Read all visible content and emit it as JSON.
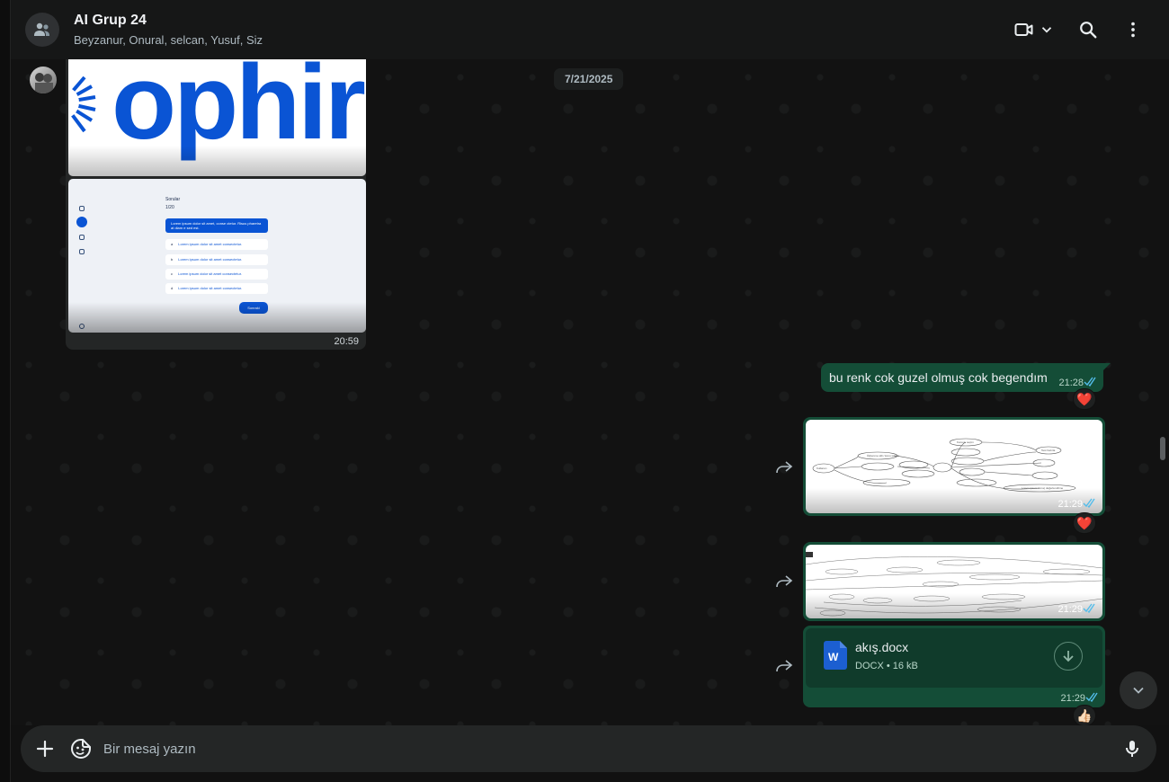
{
  "header": {
    "title": "AI Grup 24",
    "members": "Beyzanur, Onural, selcan, Yusuf, Siz",
    "icons": {
      "avatar": "group-avatar-icon",
      "video": "video-call-icon",
      "search": "search-icon",
      "menu": "more-vertical-icon"
    }
  },
  "chat": {
    "date_chip": "7/21/2025",
    "incoming": {
      "image1_word": "ophir",
      "quiz": {
        "title": "Sorular",
        "count": "1/20",
        "question": "Lorem ipsum dolor sit amet, conse ctetur. Risus pharetra at diam e sed est.",
        "options": [
          {
            "letter": "a",
            "text": "Lorem ipsum dolor sit amet consectetur."
          },
          {
            "letter": "b",
            "text": "Lorem ipsum dolor sit amet consectetur."
          },
          {
            "letter": "c",
            "text": "Lorem ipsum dolor sit amet consectetur."
          },
          {
            "letter": "d",
            "text": "Lorem ipsum dolor sit amet consectetur."
          }
        ],
        "next_button": "Sonraki"
      },
      "time": "20:59"
    },
    "outgoing": [
      {
        "kind": "text",
        "text": "bu renk cok guzel olmuş cok begendım",
        "time": "21:28",
        "reaction": "❤️"
      },
      {
        "kind": "image",
        "time": "21:29",
        "reaction": "❤️"
      },
      {
        "kind": "image",
        "time": "21:29"
      },
      {
        "kind": "document",
        "file_name": "akış.docx",
        "file_type": "DOCX",
        "file_size": "16 kB",
        "time": "21:29",
        "reaction": "👍🏻"
      }
    ],
    "tick_icon": "double-check-icon",
    "tick_color": "#53bdeb"
  },
  "composer": {
    "placeholder": "Bir mesaj yazın",
    "icons": {
      "attach": "plus-icon",
      "sticker": "sticker-icon",
      "mic": "microphone-icon"
    }
  },
  "colors": {
    "outgoing_bubble": "#144d37",
    "incoming_bubble": "#242626",
    "header_bg": "#161717",
    "accent_blue": "#0a54d4"
  }
}
